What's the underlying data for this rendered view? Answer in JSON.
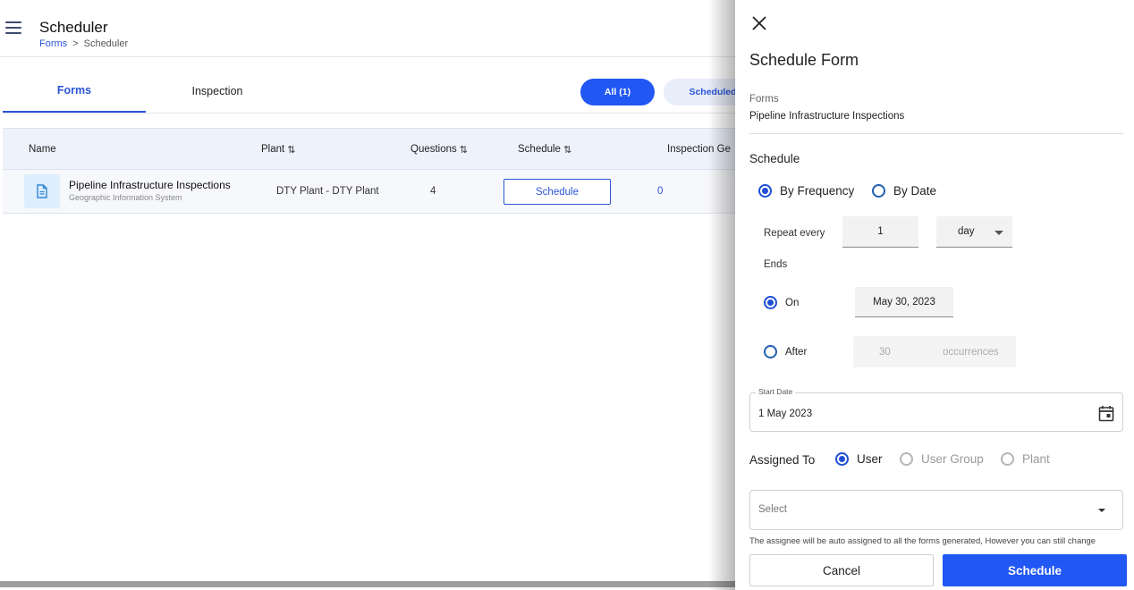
{
  "header": {
    "title": "Scheduler",
    "breadcrumb": {
      "link": "Forms",
      "separator": ">",
      "current": "Scheduler"
    }
  },
  "tabs": [
    {
      "label": "Forms",
      "active": true
    },
    {
      "label": "Inspection",
      "active": false
    }
  ],
  "filters": {
    "all": "All (1)",
    "scheduled": "Scheduled"
  },
  "table": {
    "columns": [
      "Name",
      "Plant",
      "Questions",
      "Schedule",
      "Inspection Ge"
    ],
    "sort_icon": "⇅",
    "rows": [
      {
        "name": "Pipeline Infrastructure Inspections",
        "description": "Geographic Information System",
        "plant": "DTY Plant - DTY Plant",
        "questions": "4",
        "schedule_button": "Schedule",
        "inspections": "0"
      }
    ]
  },
  "drawer": {
    "title": "Schedule Form",
    "forms_label": "Forms",
    "forms_value": "Pipeline Infrastructure Inspections",
    "schedule_label": "Schedule",
    "schedule_type": {
      "by_frequency": "By Frequency",
      "by_date": "By Date",
      "selected": "by_frequency"
    },
    "repeat_every_label": "Repeat every",
    "repeat_every_value": "1",
    "repeat_unit": "day",
    "ends_label": "Ends",
    "ends_on_label": "On",
    "ends_on_value": "May 30, 2023",
    "ends_after_label": "After",
    "ends_after_value": "30",
    "occurrences_label": "occurrences",
    "ends_selected": "on",
    "start_date_label": "Start Date",
    "start_date_value": "1 May 2023",
    "assigned_to_label": "Assigned To",
    "assign_options": {
      "user": "User",
      "user_group": "User Group",
      "plant": "Plant",
      "selected": "user"
    },
    "assignee_placeholder": "Select",
    "hint": "The assignee will be auto assigned to all the forms generated, However you can still change",
    "cancel_label": "Cancel",
    "schedule_label_button": "Schedule"
  },
  "colors": {
    "primary": "#2157f2",
    "link": "#2b55d6",
    "table_header_bg": "#eef2fb"
  },
  "icons": [
    "menu-icon",
    "close-icon",
    "document-icon",
    "calendar-icon",
    "sort-icon",
    "dropdown-caret-icon"
  ]
}
